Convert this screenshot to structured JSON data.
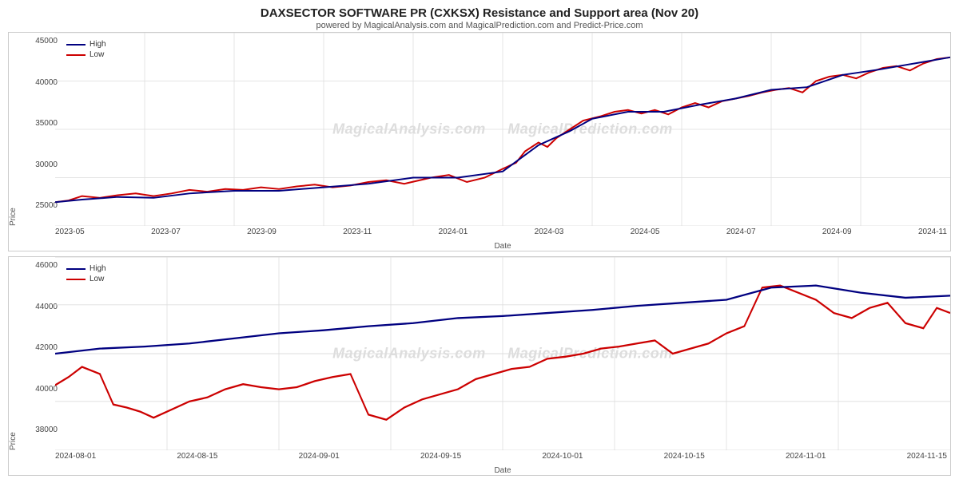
{
  "header": {
    "title": "DAXSECTOR SOFTWARE PR (CXKSX) Resistance and Support area (Nov 20)",
    "subtitle": "powered by MagicalAnalysis.com and MagicalPrediction.com and Predict-Price.com"
  },
  "chart1": {
    "legend": {
      "high_label": "High",
      "low_label": "Low",
      "high_color": "#000080",
      "low_color": "#cc0000"
    },
    "y_axis": {
      "label": "Price",
      "ticks": [
        "45000",
        "40000",
        "35000",
        "30000",
        "25000"
      ]
    },
    "x_axis": {
      "label": "Date",
      "ticks": [
        "2023-05",
        "2023-07",
        "2023-09",
        "2023-11",
        "2024-01",
        "2024-03",
        "2024-05",
        "2024-07",
        "2024-09",
        "2024-11"
      ]
    },
    "watermark": "MagicalAnalysis.com    MagicalPrediction.com"
  },
  "chart2": {
    "legend": {
      "high_label": "High",
      "low_label": "Low",
      "high_color": "#000080",
      "low_color": "#cc0000"
    },
    "y_axis": {
      "label": "Price",
      "ticks": [
        "46000",
        "44000",
        "42000",
        "40000",
        "38000"
      ]
    },
    "x_axis": {
      "label": "Date",
      "ticks": [
        "2024-08-01",
        "2024-08-15",
        "2024-09-01",
        "2024-09-15",
        "2024-10-01",
        "2024-10-15",
        "2024-11-01",
        "2024-11-15"
      ]
    },
    "watermark": "MagicalAnalysis.com    MagicalPrediction.com"
  }
}
